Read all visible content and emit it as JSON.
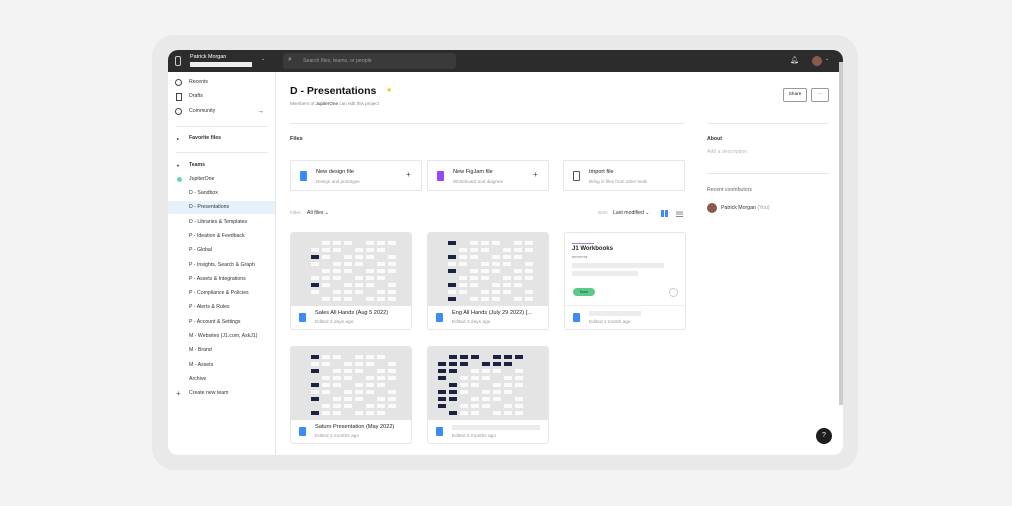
{
  "topbar": {
    "user_name": "Patrick Morgan",
    "search_placeholder": "Search files, teams, or people"
  },
  "sidebar": {
    "nav": [
      {
        "label": "Recents"
      },
      {
        "label": "Drafts"
      },
      {
        "label": "Community"
      }
    ],
    "favorites_label": "Favorite files",
    "teams_label": "Teams",
    "team_name": "JupiterOne",
    "projects": [
      "D - Sandbox",
      "D - Presentations",
      "D - Libraries & Templates",
      "P - Ideation & Feedback",
      "P - Global",
      "P - Insights, Search & Graph",
      "P - Assets & Integrations",
      "P - Compliance & Policies",
      "P - Alerts & Rules",
      "P - Account & Settings",
      "M - Websites (J1.com, AskJ1)",
      "M - Brand",
      "M - Assets",
      "Archive"
    ],
    "selected_project": "D - Presentations",
    "create_team": "Create new team"
  },
  "header": {
    "title": "D - Presentations",
    "subtitle_prefix": "Members of ",
    "subtitle_team": "JupiterOne",
    "subtitle_suffix": " can edit this project",
    "share": "Share",
    "more": "···"
  },
  "files_label": "Files",
  "actions": [
    {
      "title": "New design file",
      "sub": "Design and prototype",
      "color": "#3b8cf5"
    },
    {
      "title": "New FigJam file",
      "sub": "Whiteboard and diagram",
      "color": "#9747ff"
    },
    {
      "title": "Import file",
      "sub": "Bring in files from other tools"
    }
  ],
  "filter": {
    "label": "Filter:",
    "value": "All files"
  },
  "sort": {
    "label": "Sort:",
    "value": "Last modified"
  },
  "files": [
    {
      "name": "Sales All Hands (Aug 5 2022)",
      "edited": "Edited 2 days ago"
    },
    {
      "name": "Eng All Hands (July 29 2022) [...",
      "edited": "Edited 3 days ago"
    },
    {
      "name": "",
      "edited": "Edited 1 month ago",
      "thumb_title": "J1 Workbooks",
      "thumb_tag": "PROTOTYPE",
      "thumb_badge": "Done"
    },
    {
      "name": "Saturn Presentation (May 2022)",
      "edited": "Edited 2 months ago"
    },
    {
      "name": "",
      "edited": "Edited 6 months ago"
    }
  ],
  "right": {
    "about": "About",
    "about_placeholder": "Add a description",
    "contributors_label": "Recent contributors",
    "contributor": "Patrick Morgan",
    "contributor_you": "(You)"
  },
  "help": "?"
}
